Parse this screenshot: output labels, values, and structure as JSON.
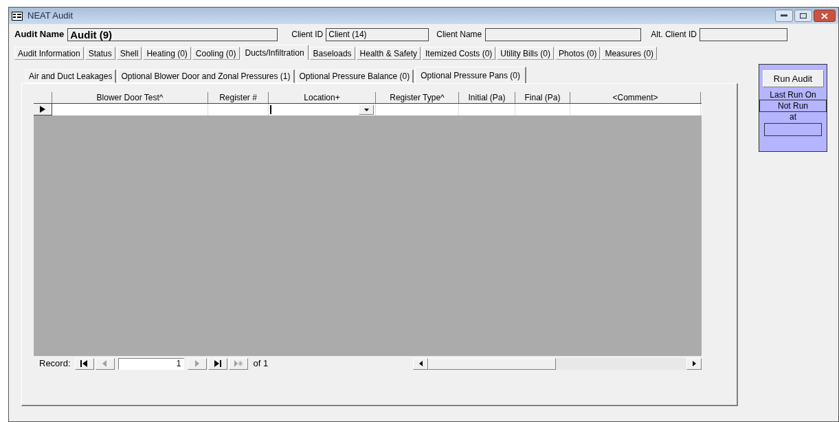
{
  "window": {
    "title": "NEAT Audit"
  },
  "header": {
    "audit_name_label": "Audit Name",
    "audit_name": "Audit (9)",
    "client_id_label": "Client ID",
    "client_id": "Client (14)",
    "client_name_label": "Client Name",
    "alt_client_id_label": "Alt. Client ID"
  },
  "tabs": [
    {
      "label": "Audit Information",
      "selected": false
    },
    {
      "label": "Status",
      "selected": false
    },
    {
      "label": "Shell",
      "selected": false
    },
    {
      "label": "Heating (0)",
      "selected": false
    },
    {
      "label": "Cooling (0)",
      "selected": false
    },
    {
      "label": "Ducts/Infiltration",
      "selected": true
    },
    {
      "label": "Baseloads",
      "selected": false
    },
    {
      "label": "Health & Safety",
      "selected": false
    },
    {
      "label": "Itemized Costs (0)",
      "selected": false
    },
    {
      "label": "Utility Bills (0)",
      "selected": false
    },
    {
      "label": "Photos (0)",
      "selected": false
    },
    {
      "label": "Measures (0)",
      "selected": false
    }
  ],
  "subtabs": [
    {
      "label": "Air and Duct Leakages",
      "selected": false
    },
    {
      "label": "Optional Blower Door and Zonal Pressures (1)",
      "selected": false
    },
    {
      "label": "Optional Pressure Balance (0)",
      "selected": false
    },
    {
      "label": "Optional Pressure Pans (0)",
      "selected": true
    }
  ],
  "table": {
    "columns": [
      "Blower Door Test^",
      "Register #",
      "Location+",
      "Register Type^",
      "Initial (Pa)",
      "Final (Pa)",
      "<Comment>"
    ]
  },
  "navigator": {
    "label": "Record:",
    "current": "1",
    "of": "of 1",
    "buttons": [
      {
        "kind": "first",
        "disabled": false
      },
      {
        "kind": "prev",
        "disabled": true
      },
      {
        "kind": "field"
      },
      {
        "kind": "next",
        "disabled": true
      },
      {
        "kind": "last",
        "disabled": false
      },
      {
        "kind": "new",
        "disabled": true
      }
    ]
  },
  "run_panel": {
    "button": "Run Audit",
    "last_run_label": "Last Run On",
    "last_run": "Not Run",
    "at_label": "at"
  }
}
